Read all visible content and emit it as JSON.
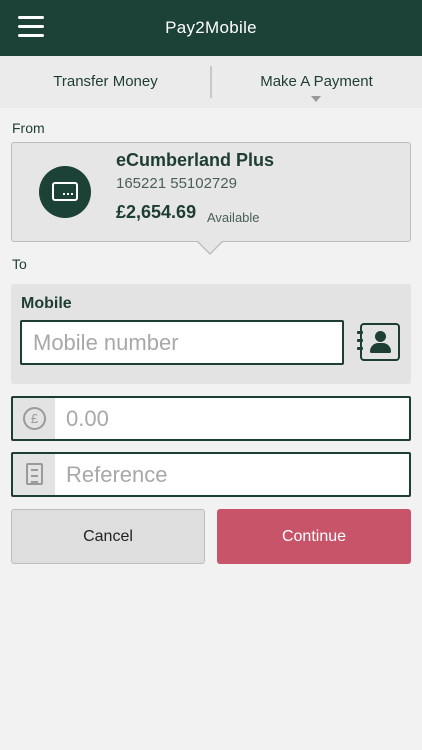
{
  "header": {
    "title": "Pay2Mobile",
    "menu_icon": "hamburger-menu-icon"
  },
  "tabs": [
    {
      "label": "Transfer Money"
    },
    {
      "label": "Make A Payment"
    }
  ],
  "from": {
    "label": "From",
    "account": {
      "name": "eCumberland Plus",
      "number": "165221 55102729",
      "balance": "£2,654.69",
      "balance_note": "Available",
      "icon": "credit-card-icon"
    }
  },
  "to": {
    "label": "To",
    "mobile_label": "Mobile",
    "mobile_placeholder": "Mobile number",
    "contact_icon": "address-book-icon"
  },
  "amount": {
    "placeholder": "0.00",
    "icon_symbol": "£"
  },
  "reference": {
    "placeholder": "Reference",
    "icon": "document-icon"
  },
  "actions": {
    "cancel_label": "Cancel",
    "continue_label": "Continue"
  },
  "colors": {
    "brand": "#1c4136",
    "accent": "#c8546a"
  }
}
